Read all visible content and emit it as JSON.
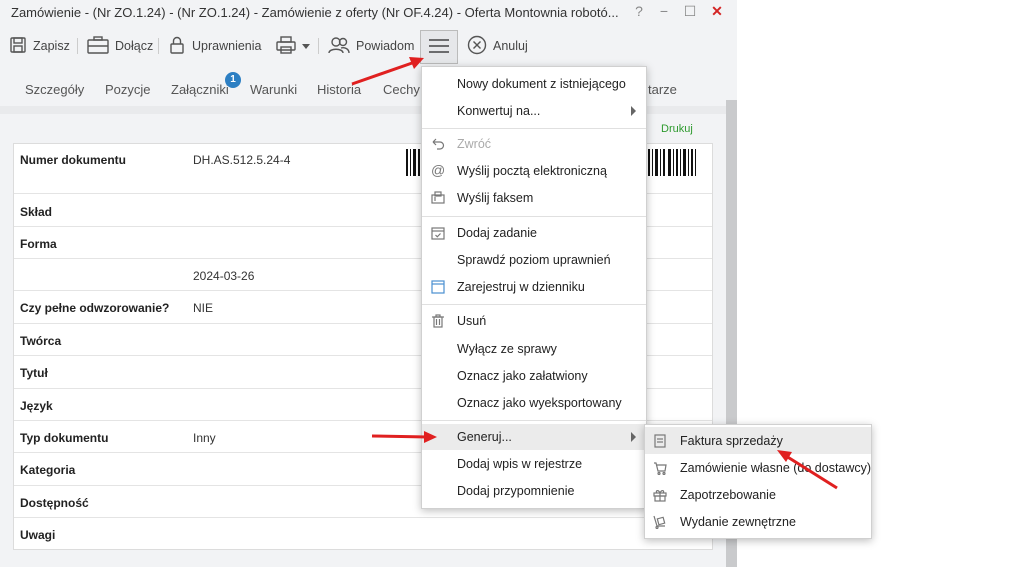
{
  "window": {
    "title": "Zamówienie - (Nr ZO.1.24) - (Nr ZO.1.24) - Zamówienie z oferty (Nr OF.4.24) - Oferta Montownia robotó...",
    "help": "?",
    "minimize": "−",
    "maximize": "☐",
    "close": "✕"
  },
  "toolbar": {
    "save": "Zapisz",
    "attach": "Dołącz",
    "permissions": "Uprawnienia",
    "notify": "Powiadom",
    "cancel": "Anuluj"
  },
  "tabs": [
    "Szczegóły",
    "Pozycje",
    "Załączniki",
    "Warunki",
    "Historia",
    "Cechy",
    "tarze"
  ],
  "attachments_badge": "1",
  "print_link": "Drukuj",
  "details": [
    {
      "label": "Numer dokumentu",
      "value": "DH.AS.512.5.24-4"
    },
    {
      "label": "Skład",
      "value": ""
    },
    {
      "label": "Forma",
      "value": ""
    },
    {
      "label": "",
      "value": "2024-03-26"
    },
    {
      "label": "Czy pełne odwzorowanie?",
      "value": "NIE"
    },
    {
      "label": "Twórca",
      "value": ""
    },
    {
      "label": "Tytuł",
      "value": ""
    },
    {
      "label": "Język",
      "value": ""
    },
    {
      "label": "Typ dokumentu",
      "value": "Inny"
    },
    {
      "label": "Kategoria",
      "value": ""
    },
    {
      "label": "Dostępność",
      "value": ""
    },
    {
      "label": "Uwagi",
      "value": ""
    }
  ],
  "menu": {
    "new_from_existing": "Nowy dokument z istniejącego",
    "convert": "Konwertuj na...",
    "return": "Zwróć",
    "send_email": "Wyślij pocztą elektroniczną",
    "send_fax": "Wyślij faksem",
    "add_task": "Dodaj zadanie",
    "check_permissions": "Sprawdź poziom uprawnień",
    "register_journal": "Zarejestruj w dzienniku",
    "delete": "Usuń",
    "exclude_case": "Wyłącz ze sprawy",
    "mark_done": "Oznacz jako załatwiony",
    "mark_exported": "Oznacz jako wyeksportowany",
    "generate": "Generuj...",
    "add_register": "Dodaj wpis w rejestrze",
    "add_reminder": "Dodaj przypomnienie"
  },
  "submenu": {
    "sales_invoice": "Faktura sprzedaży",
    "own_order": "Zamówienie własne (do dostawcy)",
    "demand": "Zapotrzebowanie",
    "external_issue": "Wydanie zewnętrzne"
  },
  "annotation_color": "#e02020"
}
